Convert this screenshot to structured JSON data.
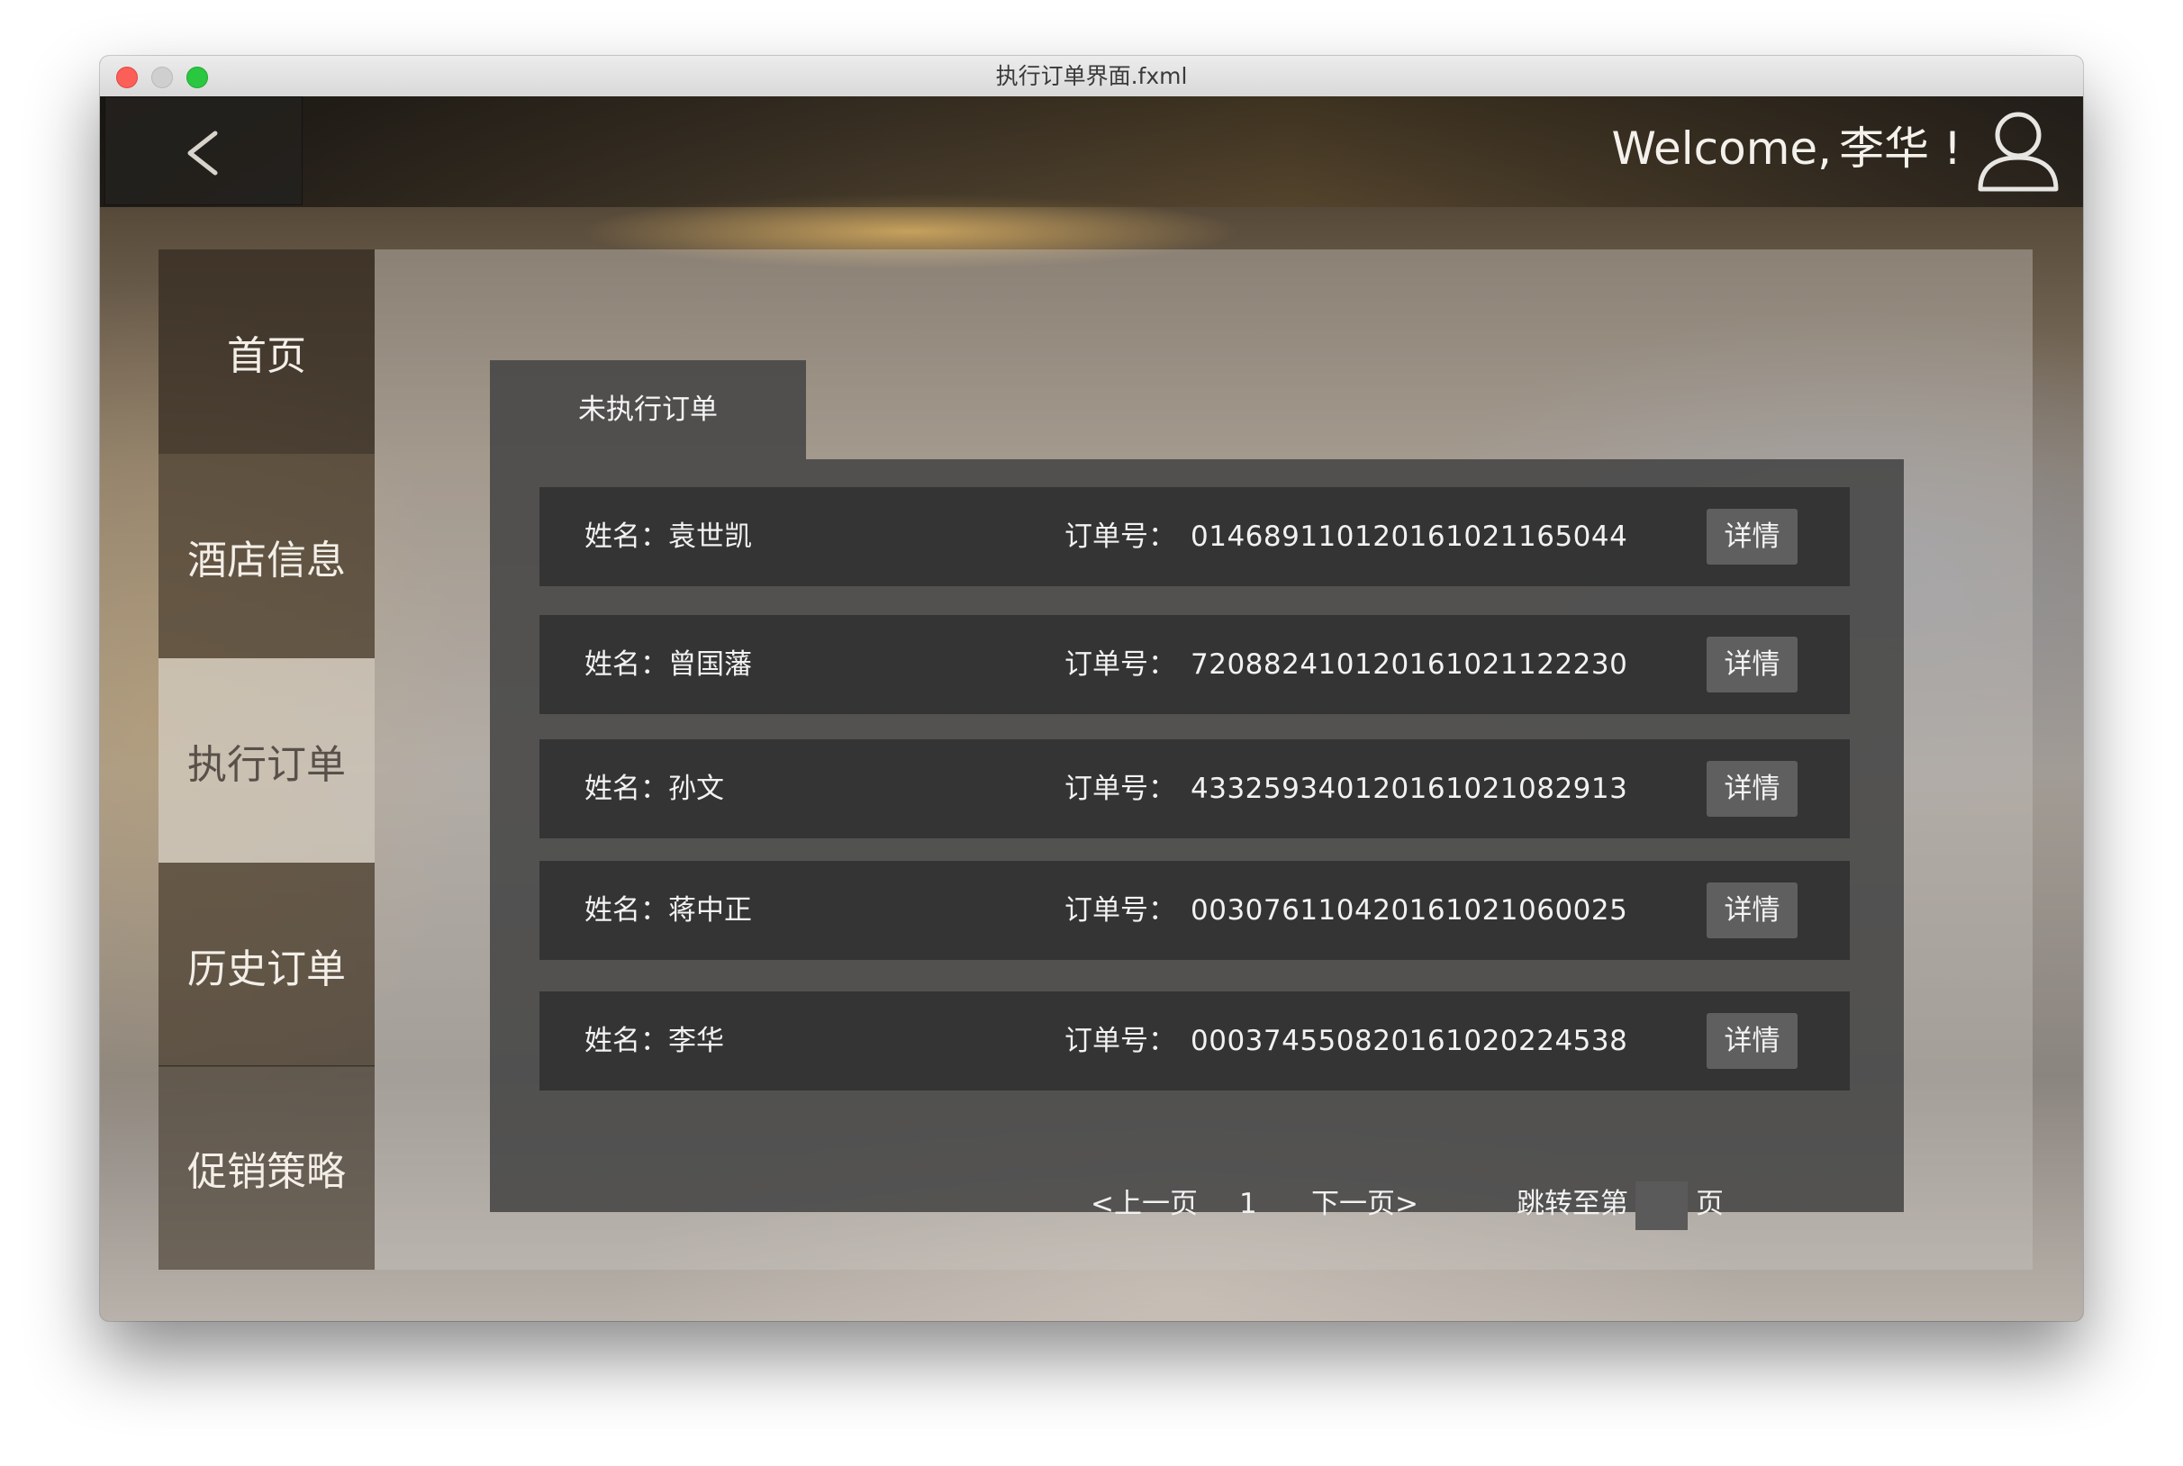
{
  "window": {
    "title": "执行订单界面.fxml"
  },
  "header": {
    "welcome_text": "Welcome,",
    "user_name": "李华 !"
  },
  "sidebar": {
    "items": [
      {
        "label": "首页"
      },
      {
        "label": "酒店信息"
      },
      {
        "label": "执行订单",
        "active": true
      },
      {
        "label": "历史订单"
      },
      {
        "label": "促销策略"
      }
    ]
  },
  "tab": {
    "label": "未执行订单"
  },
  "orders": [
    {
      "name": "姓名：袁世凯",
      "order_label": "订单号：",
      "order_no": "0146891101201610211650​44",
      "detail_label": "详情"
    },
    {
      "name": "姓名：曾国藩",
      "order_label": "订单号：",
      "order_no": "720882410120161021122230",
      "detail_label": "详情"
    },
    {
      "name": "姓名：孙文",
      "order_label": "订单号：",
      "order_no": "433259340120161021082913",
      "detail_label": "详情"
    },
    {
      "name": "姓名：蒋中正",
      "order_label": "订单号：",
      "order_no": "003076110420161021060025",
      "detail_label": "详情"
    },
    {
      "name": "姓名：李华",
      "order_label": "订单号：",
      "order_no": "000374550820161020224538",
      "detail_label": "详情"
    }
  ],
  "pagination": {
    "prev_label": "<上一页",
    "current_page": "1",
    "next_label": "下一页>",
    "jump_label": "跳转至第",
    "page_suffix": "页",
    "jump_value": ""
  }
}
